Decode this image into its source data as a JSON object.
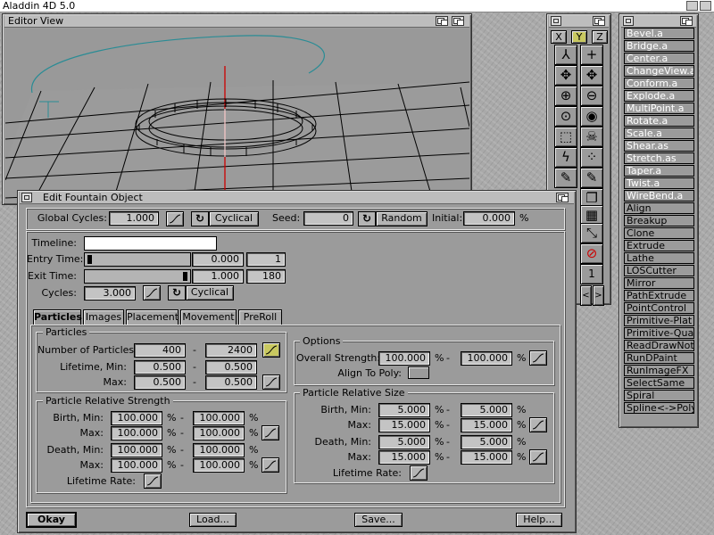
{
  "app": {
    "title": "Aladdin 4D 5.0"
  },
  "editor": {
    "title": "Editor View"
  },
  "axes": {
    "x": "X",
    "y": "Y",
    "z": "Z"
  },
  "plugins": {
    "items": [
      "Bevel.a",
      "Bridge.a",
      "Center.a",
      "ChangeView.a",
      "Conform.a",
      "Explode.a",
      "MultiPoint.a",
      "Rotate.a",
      "Scale.a",
      "Shear.as",
      "Stretch.as",
      "Taper.a",
      "Twist.a",
      "WireBend.a",
      "Align",
      "Breakup",
      "Clone",
      "Extrude",
      "Lathe",
      "LOSCutter",
      "Mirror",
      "PathExtrude",
      "PointControl",
      "Primitive-Plat",
      "Primitive-Quad",
      "ReadDrawNote",
      "RunDPaint",
      "RunImageFX",
      "SelectSame",
      "Spiral",
      "Spline<->Poly"
    ]
  },
  "toolbox": {
    "page_number": "1"
  },
  "dialog": {
    "title": "Edit Fountain Object",
    "global": {
      "cycles_label": "Global Cycles:",
      "cycles": "1.000",
      "cyclical": "Cyclical",
      "seed_label": "Seed:",
      "seed": "0",
      "random": "Random",
      "initial_label": "Initial:",
      "initial": "0.000",
      "pct": "%"
    },
    "timeline": {
      "label": "Timeline:",
      "entry_label": "Entry Time:",
      "entry": "0.000",
      "entry_frame": "1",
      "exit_label": "Exit Time:",
      "exit": "1.000",
      "exit_frame": "180",
      "cycles_label": "Cycles:",
      "cycles": "3.000",
      "cyclical": "Cyclical"
    },
    "tabs": [
      "Particles",
      "Images",
      "Placement",
      "Movement",
      "PreRoll"
    ],
    "particles": {
      "group": "Particles",
      "num_label": "Number of Particles:",
      "num_min": "400",
      "num_max": "2400",
      "lifemin_label": "Lifetime, Min:",
      "lifemin_min": "0.500",
      "lifemin_max": "0.500",
      "max_label": "Max:",
      "lifemax_min": "0.500",
      "lifemax_max": "0.500"
    },
    "options": {
      "group": "Options",
      "strength_label": "Overall Strength:",
      "strength_min": "100.000",
      "strength_max": "100.000",
      "align_label": "Align To Poly:"
    },
    "prs": {
      "group": "Particle Relative Strength",
      "birthmin_label": "Birth, Min:",
      "birthmin_a": "100.000",
      "birthmin_b": "100.000",
      "max_label": "Max:",
      "birthmax_a": "100.000",
      "birthmax_b": "100.000",
      "deathmin_label": "Death, Min:",
      "deathmin_a": "100.000",
      "deathmin_b": "100.000",
      "deathmax_a": "100.000",
      "deathmax_b": "100.000",
      "rate_label": "Lifetime Rate:"
    },
    "prz": {
      "group": "Particle Relative Size",
      "birthmin_label": "Birth, Min:",
      "birthmin_a": "5.000",
      "birthmin_b": "5.000",
      "max_label": "Max:",
      "birthmax_a": "15.000",
      "birthmax_b": "15.000",
      "deathmin_label": "Death, Min:",
      "deathmin_a": "5.000",
      "deathmin_b": "5.000",
      "deathmax_a": "15.000",
      "deathmax_b": "15.000",
      "rate_label": "Lifetime Rate:"
    },
    "buttons": {
      "okay": "Okay",
      "load": "Load...",
      "save": "Save...",
      "help": "Help..."
    },
    "dash": "-"
  }
}
